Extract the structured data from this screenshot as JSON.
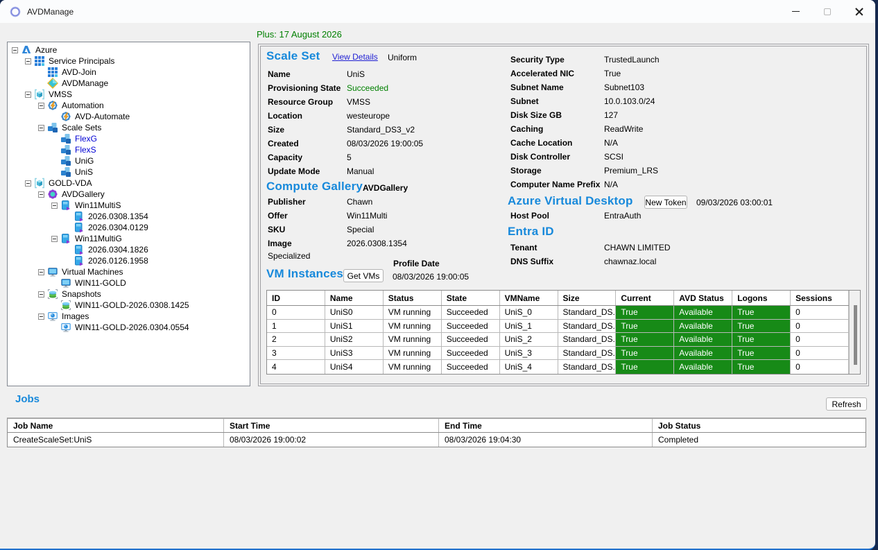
{
  "window": {
    "title": "AVDManage",
    "plus_date": "Plus: 17 August 2026"
  },
  "colors": {
    "accent_blue": "#1789db",
    "status_green": "#008000",
    "cell_green": "#178a17",
    "link_blue": "#1f1fd3",
    "tree_link_blue": "#0000d4"
  },
  "tree": {
    "items": [
      {
        "label": "Azure"
      },
      {
        "label": "Service Principals"
      },
      {
        "label": "AVD-Join"
      },
      {
        "label": "AVDManage"
      },
      {
        "label": "VMSS"
      },
      {
        "label": "Automation"
      },
      {
        "label": "AVD-Automate"
      },
      {
        "label": "Scale Sets"
      },
      {
        "label": "FlexG"
      },
      {
        "label": "FlexS"
      },
      {
        "label": "UniG"
      },
      {
        "label": "UniS"
      },
      {
        "label": "GOLD-VDA"
      },
      {
        "label": "AVDGallery"
      },
      {
        "label": "Win11MultiS"
      },
      {
        "label": "2026.0308.1354"
      },
      {
        "label": "2026.0304.0129"
      },
      {
        "label": "Win11MultiG"
      },
      {
        "label": "2026.0304.1826"
      },
      {
        "label": "2026.0126.1958"
      },
      {
        "label": "Virtual Machines"
      },
      {
        "label": "WIN11-GOLD"
      },
      {
        "label": "Snapshots"
      },
      {
        "label": "WIN11-GOLD-2026.0308.1425"
      },
      {
        "label": "Images"
      },
      {
        "label": "WIN11-GOLD-2026.0304.0554"
      }
    ]
  },
  "details": {
    "scale_set": {
      "heading": "Scale Set",
      "view_details": "View Details",
      "mode": "Uniform",
      "rows": [
        {
          "label": "Name",
          "value": "UniS"
        },
        {
          "label": "Provisioning State",
          "value": "Succeeded"
        },
        {
          "label": "Resource Group",
          "value": "VMSS"
        },
        {
          "label": "Location",
          "value": "westeurope"
        },
        {
          "label": "Size",
          "value": "Standard_DS3_v2"
        },
        {
          "label": "Created",
          "value": "08/03/2026 19:00:05"
        },
        {
          "label": "Capacity",
          "value": "5"
        },
        {
          "label": "Update Mode",
          "value": "Manual"
        }
      ]
    },
    "right_rows": [
      {
        "label": "Security Type",
        "value": "TrustedLaunch"
      },
      {
        "label": "Accelerated NIC",
        "value": "True"
      },
      {
        "label": "Subnet Name",
        "value": "Subnet103"
      },
      {
        "label": "Subnet",
        "value": "10.0.103.0/24"
      },
      {
        "label": "Disk Size GB",
        "value": "127"
      },
      {
        "label": "Caching",
        "value": "ReadWrite"
      },
      {
        "label": "Cache Location",
        "value": "N/A"
      },
      {
        "label": "Disk Controller",
        "value": "SCSI"
      },
      {
        "label": "Storage",
        "value": "Premium_LRS"
      },
      {
        "label": "Computer Name Prefix",
        "value": "N/A"
      }
    ],
    "compute_gallery": {
      "heading": "Compute Gallery",
      "gallery_name": "AVDGallery",
      "rows": [
        {
          "label": "Publisher",
          "value": "Chawn"
        },
        {
          "label": "Offer",
          "value": "Win11Multi"
        },
        {
          "label": "SKU",
          "value": "Special"
        },
        {
          "label": "Image",
          "value": "2026.0308.1354"
        }
      ],
      "specialized": "Specialized"
    },
    "profile_date_label": "Profile Date",
    "vm_instances": {
      "heading": "VM Instances",
      "get_vms_button": "Get VMs",
      "profile_date": "08/03/2026 19:00:05"
    },
    "avd": {
      "heading": "Azure Virtual Desktop",
      "new_token_button": "New Token",
      "token_date": "09/03/2026 03:00:01",
      "host_pool_label": "Host Pool",
      "host_pool": "EntraAuth"
    },
    "entra": {
      "heading": "Entra ID",
      "rows": [
        {
          "label": "Tenant",
          "value": "CHAWN LIMITED"
        },
        {
          "label": "DNS Suffix",
          "value": "chawnaz.local"
        }
      ]
    }
  },
  "vm_table": {
    "headers": [
      "ID",
      "Name",
      "Status",
      "State",
      "VMName",
      "Size",
      "Current",
      "AVD Status",
      "Logons",
      "Sessions"
    ],
    "rows": [
      [
        "0",
        "UniS0",
        "VM running",
        "Succeeded",
        "UniS_0",
        "Standard_DS...",
        "True",
        "Available",
        "True",
        "0"
      ],
      [
        "1",
        "UniS1",
        "VM running",
        "Succeeded",
        "UniS_1",
        "Standard_DS...",
        "True",
        "Available",
        "True",
        "0"
      ],
      [
        "2",
        "UniS2",
        "VM running",
        "Succeeded",
        "UniS_2",
        "Standard_DS...",
        "True",
        "Available",
        "True",
        "0"
      ],
      [
        "3",
        "UniS3",
        "VM running",
        "Succeeded",
        "UniS_3",
        "Standard_DS...",
        "True",
        "Available",
        "True",
        "0"
      ],
      [
        "4",
        "UniS4",
        "VM running",
        "Succeeded",
        "UniS_4",
        "Standard_DS...",
        "True",
        "Available",
        "True",
        "0"
      ]
    ]
  },
  "jobs": {
    "heading": "Jobs",
    "refresh_button": "Refresh",
    "headers": [
      "Job Name",
      "Start Time",
      "End Time",
      "Job Status"
    ],
    "rows": [
      [
        "CreateScaleSet:UniS",
        "08/03/2026 19:00:02",
        "08/03/2026 19:04:30",
        "Completed"
      ]
    ]
  }
}
